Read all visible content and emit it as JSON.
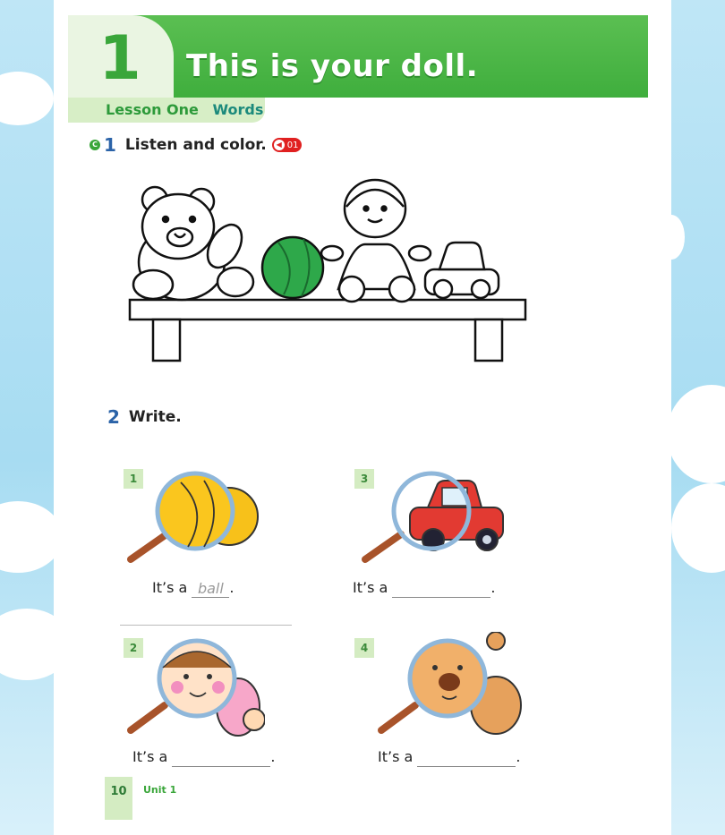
{
  "header": {
    "unit_number": "1",
    "title": "This is your doll.",
    "lesson": "Lesson One",
    "lesson_part": "Words"
  },
  "section1": {
    "number": "1",
    "instruction": "Listen and color.",
    "audio_track": "01",
    "toys": [
      "teddy-bear",
      "ball",
      "doll",
      "car"
    ]
  },
  "section2": {
    "number": "2",
    "instruction": "Write.",
    "items": [
      {
        "number": "1",
        "prefix": "It’s a",
        "answer": "ball",
        "suffix": ".",
        "picture": "ball"
      },
      {
        "number": "2",
        "prefix": "It’s a",
        "answer": "",
        "suffix": ".",
        "picture": "doll"
      },
      {
        "number": "3",
        "prefix": "It’s a",
        "answer": "",
        "suffix": ".",
        "picture": "car"
      },
      {
        "number": "4",
        "prefix": "It’s a",
        "answer": "",
        "suffix": ".",
        "picture": "teddy-bear"
      }
    ]
  },
  "footer": {
    "page_number": "10",
    "unit_label": "Unit 1"
  },
  "colors": {
    "header_green": "#3fae3d",
    "lesson_bar": "#d7eec6",
    "section_number_blue": "#2b63a8",
    "audio_red": "#e02020",
    "background_sky": "#a7dcf2"
  }
}
